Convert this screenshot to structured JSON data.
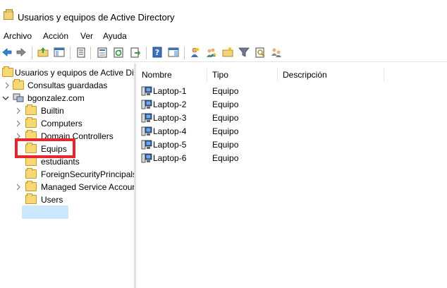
{
  "window": {
    "title": "Usuarios y equipos de Active Directory"
  },
  "menu": {
    "items": [
      "Archivo",
      "Acción",
      "Ver",
      "Ayuda"
    ]
  },
  "toolbar": {
    "buttons": [
      "back-arrow-icon",
      "forward-arrow-icon",
      "up-folder-icon",
      "show-hide-console-tree-icon",
      "delete-icon",
      "properties-icon",
      "refresh-icon",
      "export-list-icon",
      "help-icon",
      "show-action-pane-icon",
      "create-user-icon",
      "create-group-icon",
      "create-ou-icon",
      "filter-icon",
      "find-icon",
      "add-to-group-icon"
    ]
  },
  "tree": {
    "root": "Usuarios y equipos de Active Dire",
    "saved_queries": "Consultas guardadas",
    "domain": "bgonzalez.com",
    "children": [
      "Builtin",
      "Computers",
      "Domain Controllers",
      "Equips",
      "estudiants",
      "ForeignSecurityPrincipals",
      "Managed Service Accour",
      "Users"
    ],
    "selected": "Equips"
  },
  "list": {
    "columns": [
      "Nombre",
      "Tipo",
      "Descripción"
    ],
    "rows": [
      {
        "name": "Laptop-1",
        "type": "Equipo"
      },
      {
        "name": "Laptop-2",
        "type": "Equipo"
      },
      {
        "name": "Laptop-3",
        "type": "Equipo"
      },
      {
        "name": "Laptop-4",
        "type": "Equipo"
      },
      {
        "name": "Laptop-5",
        "type": "Equipo"
      },
      {
        "name": "Laptop-6",
        "type": "Equipo"
      }
    ]
  },
  "colors": {
    "highlight_box": "#e8262d",
    "selection": "#cce8ff",
    "folder": "#f8d775"
  }
}
